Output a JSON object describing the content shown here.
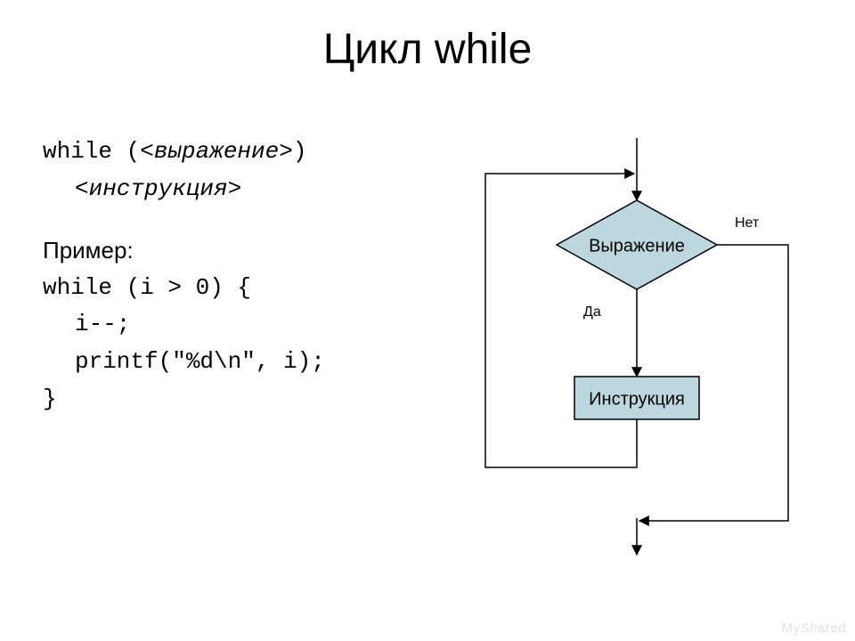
{
  "title": "Цикл while",
  "syntax": {
    "line1_pre": "while (",
    "line1_expr": "<выражение>",
    "line1_post": ")",
    "line2_instr": "<инструкция>"
  },
  "example_label": "Пример:",
  "example": {
    "l1": "while (i > 0) {",
    "l2": "i--;",
    "l3": "printf(\"%d\\n\", i);",
    "l4": "}"
  },
  "flow": {
    "decision": "Выражение",
    "process": "Инструкция",
    "yes": "Да",
    "no": "Нет"
  },
  "watermark": "MyShared",
  "colors": {
    "node_fill": "#bdd7de",
    "node_stroke": "#000000",
    "line": "#000000"
  }
}
